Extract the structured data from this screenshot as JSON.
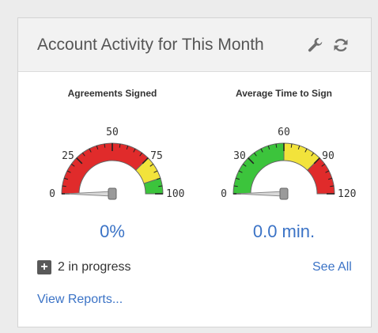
{
  "panel": {
    "title": "Account Activity for This Month",
    "icons": [
      "wrench-icon",
      "refresh-icon"
    ]
  },
  "gauges": [
    {
      "title": "Agreements Signed",
      "min": 0,
      "max": 100,
      "tick_labels": [
        "0",
        "25",
        "50",
        "75",
        "100"
      ],
      "value_text": "0%",
      "value": 0,
      "zones": [
        {
          "from": 0,
          "to": 75,
          "color": "#e02b2b"
        },
        {
          "from": 75,
          "to": 90,
          "color": "#f2e33b"
        },
        {
          "from": 90,
          "to": 100,
          "color": "#3cc43c"
        }
      ]
    },
    {
      "title": "Average Time to Sign",
      "min": 0,
      "max": 120,
      "tick_labels": [
        "0",
        "30",
        "60",
        "90",
        "120"
      ],
      "value_text": "0.0 min.",
      "value": 0,
      "zones": [
        {
          "from": 0,
          "to": 60,
          "color": "#3cc43c"
        },
        {
          "from": 60,
          "to": 90,
          "color": "#f2e33b"
        },
        {
          "from": 90,
          "to": 120,
          "color": "#e02b2b"
        }
      ]
    }
  ],
  "footer": {
    "in_progress": "2 in progress",
    "see_all": "See All",
    "view_reports": "View Reports..."
  },
  "colors": {
    "link": "#3b73c6",
    "header_bg": "#f2f2f2"
  }
}
